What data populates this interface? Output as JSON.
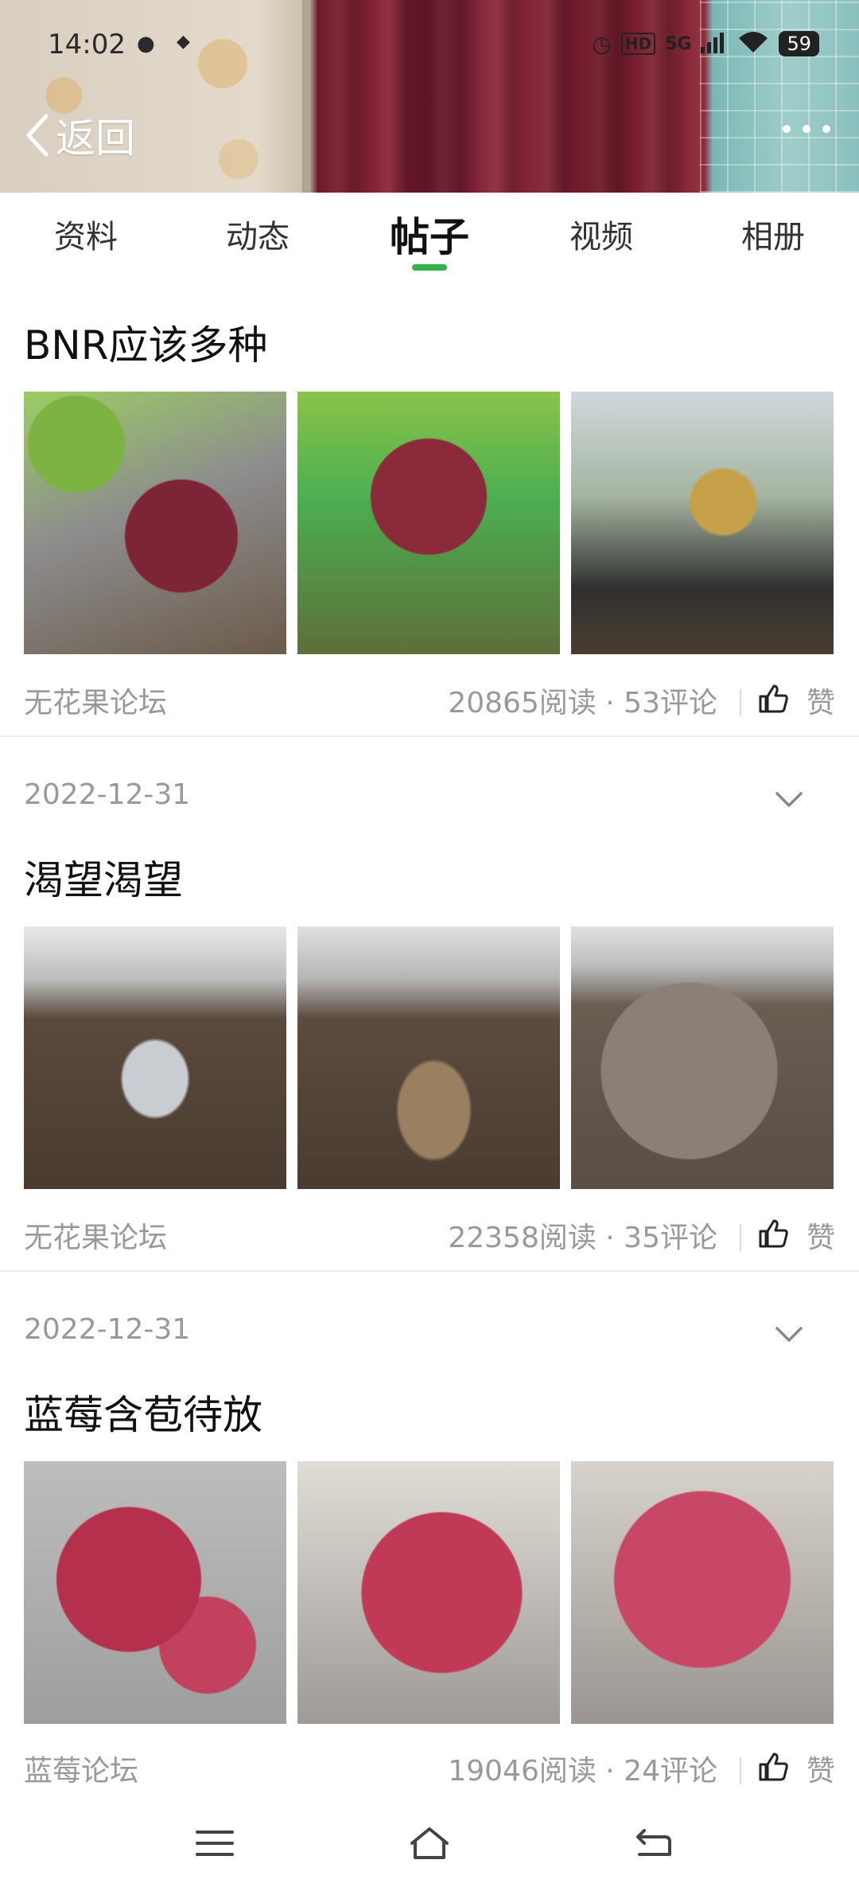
{
  "status_bar": {
    "time": "14:02",
    "network": "5G",
    "battery": "59"
  },
  "header": {
    "back_label": "返回"
  },
  "tabs": [
    {
      "label": "资料"
    },
    {
      "label": "动态"
    },
    {
      "label": "帖子"
    },
    {
      "label": "视频"
    },
    {
      "label": "相册"
    }
  ],
  "active_tab": "帖子",
  "accent_color": "#2fb34a",
  "posts": [
    {
      "title": "BNR应该多种",
      "forum": "无花果论坛",
      "stats": "20865阅读 · 53评论",
      "like_label": "赞"
    },
    {
      "date": "2022-12-31",
      "title": "渴望渴望",
      "forum": "无花果论坛",
      "stats": "22358阅读 · 35评论",
      "like_label": "赞"
    },
    {
      "date": "2022-12-31",
      "title": "蓝莓含苞待放",
      "forum": "蓝莓论坛",
      "stats": "19046阅读 · 24评论",
      "like_label": "赞"
    }
  ],
  "icons": {
    "more": "more-dots-icon",
    "back": "chevron-left-icon",
    "like": "thumbs-up-icon",
    "expand": "chevron-down-icon",
    "nav_menu": "menu-icon",
    "nav_home": "home-icon",
    "nav_back": "back-icon"
  }
}
